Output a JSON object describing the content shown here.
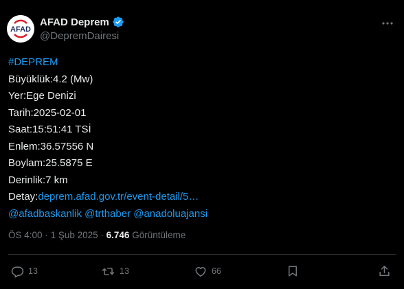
{
  "account": {
    "display_name": "AFAD Deprem",
    "handle": "@DepremDairesi",
    "avatar_text": "AFAD"
  },
  "tweet": {
    "hashtag": "#DEPREM",
    "lines": [
      "Büyüklük:4.2 (Mw)",
      "Yer:Ege Denizi",
      "Tarih:2025-02-01",
      "Saat:15:51:41 TSİ",
      "Enlem:36.57556 N",
      "Boylam:25.5875 E",
      "Derinlik:7 km"
    ],
    "detail_label": "Detay:",
    "detail_link": "deprem.afad.gov.tr/event-detail/5…",
    "mentions": [
      "@afadbaskanlik",
      "@trthaber",
      "@anadoluajansi"
    ]
  },
  "meta": {
    "time": "ÖS 4:00",
    "separator": "·",
    "date": "1 Şub 2025",
    "views_count": "6.746",
    "views_label": "Görüntüleme"
  },
  "actions": {
    "reply_count": "13",
    "retweet_count": "13",
    "like_count": "66"
  },
  "colors": {
    "background": "#000000",
    "text": "#e7e9ea",
    "secondary": "#71767b",
    "link": "#1d9bf0",
    "divider": "#2f3336",
    "avatar_red": "#d6212b",
    "avatar_navy": "#1b2a5a"
  },
  "icons": {
    "verified": "verified-badge-icon",
    "more": "more-dots-icon",
    "reply": "reply-bubble-icon",
    "retweet": "retweet-arrows-icon",
    "like": "heart-icon",
    "bookmark": "bookmark-icon",
    "share": "share-upload-icon"
  }
}
